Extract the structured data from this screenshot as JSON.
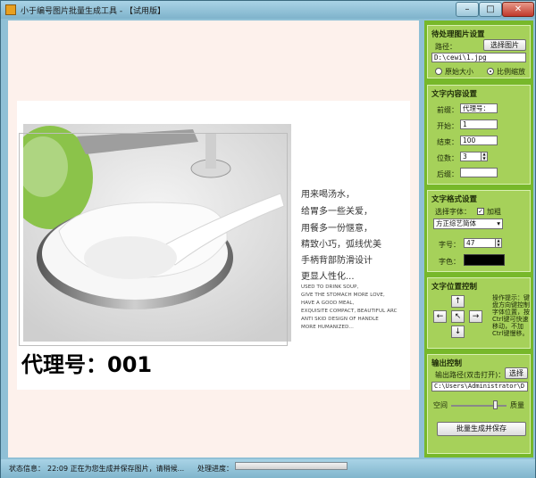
{
  "window": {
    "title": "小于编号图片批量生成工具 - 【试用版】",
    "minimize_glyph": "–",
    "maximize_glyph": "□",
    "close_glyph": "✕"
  },
  "preview": {
    "copy_lines": [
      "用来喝汤水，",
      "给胃多一些关爱，",
      "用餐多一份惬意，",
      "精致小巧，弧线优美",
      "手柄背部防滑设计",
      "更显人性化..."
    ],
    "english_lines": [
      "USED TO DRINK SOUP,",
      "GIVE THE STOMACH MORE LOVE,",
      "HAVE A GOOD MEAL,",
      "EXQUISITE COMPACT, BEAUTIFUL ARC",
      "ANTI SKID DESIGN OF HANDLE",
      "MORE HUMANIZED..."
    ],
    "watermark": "代理号：001"
  },
  "image_settings": {
    "title": "待处理图片设置",
    "path_label": "路径：",
    "select_button": "选择图片",
    "path_value": "D:\\cewi\\1.jpg",
    "option_original": "原始大小",
    "option_scale": "比例缩放",
    "selected": "比例缩放"
  },
  "text_content": {
    "title": "文字内容设置",
    "prefix_label": "前缀：",
    "prefix_value": "代理号：",
    "start_label": "开始：",
    "start_value": "1",
    "end_label": "结束：",
    "end_value": "100",
    "digits_label": "位数：",
    "digits_value": "3",
    "suffix_label": "后缀：",
    "suffix_value": ""
  },
  "text_format": {
    "title": "文字格式设置",
    "font_label": "选择字体：",
    "bold_label": "加粗",
    "bold_checked": true,
    "font_value": "方正综艺简体",
    "size_label": "字号：",
    "size_value": "47",
    "color_label": "字色：",
    "color_value": "#000000"
  },
  "position": {
    "title": "文字位置控制",
    "up": "↑",
    "left": "←",
    "center": "↖",
    "right": "→",
    "down": "↓",
    "hint": "操作提示：键盘方向键控制字体位置，按Ctrl键可快速移动，不加Ctrl键慢移。"
  },
  "output": {
    "title": "输出控制",
    "path_label": "输出路径(双击打开)：",
    "select_button": "选择",
    "path_value": "C:\\Users\\Administrator\\D",
    "space_label": "空间",
    "quality_label": "质量",
    "quality_level": 0.82,
    "generate_button": "批量生成并保存"
  },
  "status": {
    "label": "状态信息：",
    "message": "22:09 正在为您生成并保存图片，请稍候...",
    "progress_label": "处理进度：",
    "progress_value": 0.0
  },
  "colors": {
    "panel_bg": "#77b82a",
    "group_bg": "#a6d15a",
    "canvas_bg": "#fdf1ec"
  }
}
